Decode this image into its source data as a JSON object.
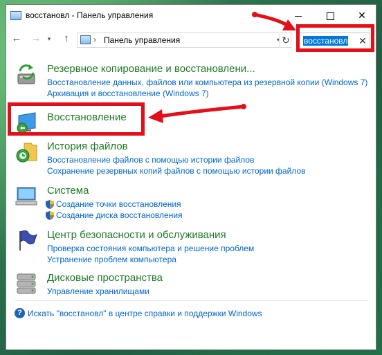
{
  "window": {
    "title": "восстановл - Панель управления",
    "address": "Панель управления",
    "search_value": "восстановл"
  },
  "items": [
    {
      "title": "Резервное копирование и восстановлени...",
      "links": [
        "Восстановление данных, файлов или компьютера из резервной копии (Windows 7)",
        "Архивация и восстановление (Windows 7)"
      ]
    },
    {
      "title": "Восстановление",
      "links": []
    },
    {
      "title": "История файлов",
      "links": [
        "Восстановление файлов с помощью истории файлов",
        "Сохранение резервных копий файлов с помощью истории файлов"
      ]
    },
    {
      "title": "Система",
      "links": [
        "Создание точки восстановления",
        "Создание диска восстановления"
      ]
    },
    {
      "title": "Центр безопасности и обслуживания",
      "links": [
        "Проверка состояния компьютера и решение проблем",
        "Устранение проблем компьютера"
      ]
    },
    {
      "title": "Дисковые пространства",
      "links": [
        "Управление хранилищами"
      ]
    }
  ],
  "help": {
    "text": "Искать \"восстановл\" в центре справки и поддержки Windows"
  },
  "icons": {
    "window": "control-panel-icon",
    "back": "back-arrow-icon",
    "forward": "forward-arrow-icon",
    "up": "up-arrow-icon",
    "refresh": "refresh-icon",
    "clear": "close-icon",
    "help": "help-icon"
  },
  "colors": {
    "highlight": "#e3101a",
    "title_green": "#1e7a25",
    "link_blue": "#0066cc",
    "selection": "#0078d7"
  }
}
